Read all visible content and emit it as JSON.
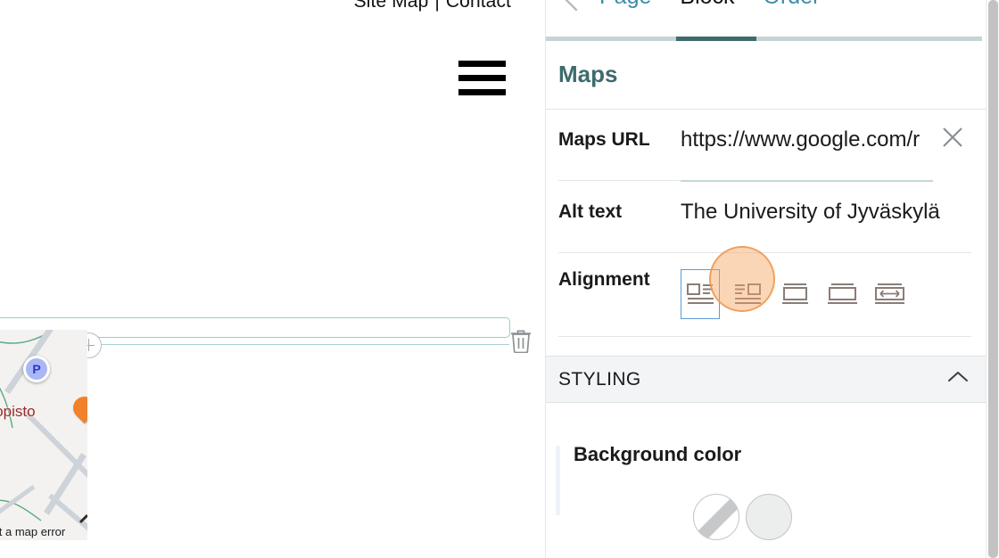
{
  "preview": {
    "site_nav": {
      "site_map": "Site Map",
      "separator": "|",
      "contact": "Contact"
    },
    "menu_icon": "hamburger-menu-icon",
    "insert_block_icon": "plus-circle-icon",
    "delete_icon": "trash-icon",
    "map": {
      "parking_marker": "P",
      "place_label": "n yliopisto",
      "footer_text": "port a map error",
      "poi_marker": "orange-place-marker"
    }
  },
  "panel": {
    "back_icon": "chevron-left-icon",
    "tabs": [
      {
        "label": "Page",
        "active": false
      },
      {
        "label": "Block",
        "active": true
      },
      {
        "label": "Order",
        "active": false
      }
    ],
    "block_title": "Maps",
    "fields": [
      {
        "label": "Maps URL",
        "value": "https://www.google.com/r",
        "clear_icon": "close-x-icon"
      },
      {
        "label": "Alt text",
        "value": "The University of Jyväskylä"
      }
    ],
    "alignment": {
      "label": "Alignment",
      "options": [
        {
          "name": "align-left-wrap",
          "selected": true
        },
        {
          "name": "align-right-wrap",
          "selected": false
        },
        {
          "name": "align-center-small",
          "selected": false
        },
        {
          "name": "align-center-wide",
          "selected": false
        },
        {
          "name": "align-full-width",
          "selected": false
        }
      ]
    },
    "styling": {
      "header": "STYLING",
      "collapse_icon": "chevron-up-icon",
      "background_color_label": "Background color",
      "swatches": [
        {
          "name": "no-color-swatch",
          "color": "none"
        },
        {
          "name": "light-gray-swatch",
          "color": "#eceded"
        }
      ]
    }
  },
  "colors": {
    "accent_teal": "#3e6b6d",
    "tab_link": "#3d8ba8",
    "selected_border": "#5b9bd5",
    "cursor_highlight": "#f4a460"
  }
}
